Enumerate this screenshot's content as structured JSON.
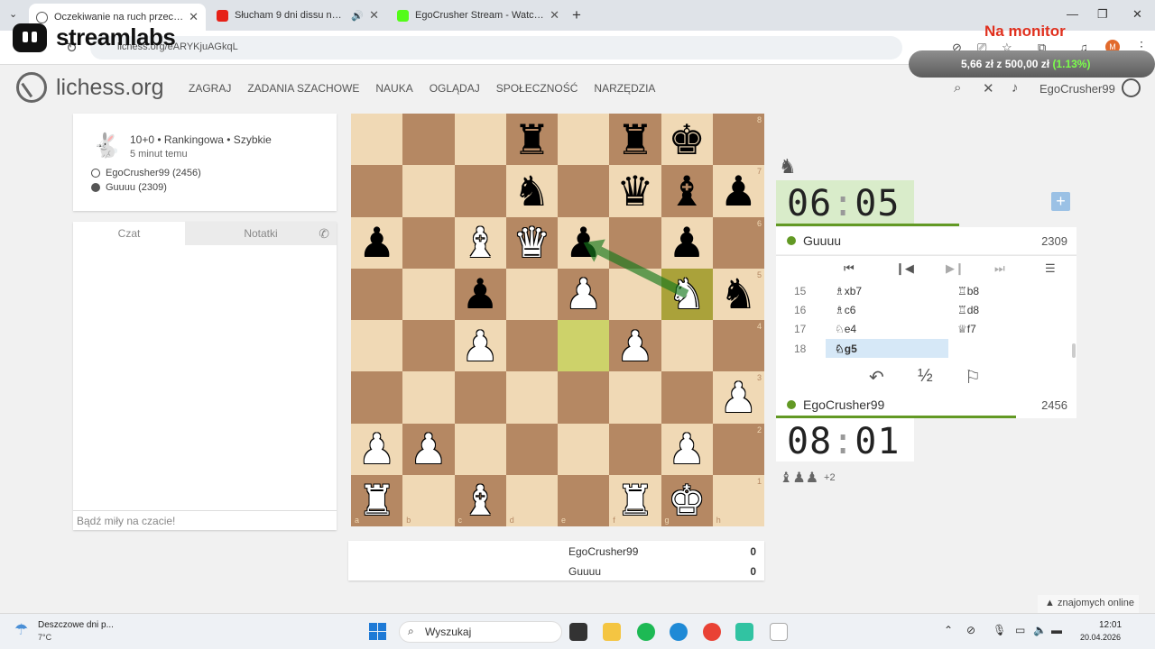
{
  "browser": {
    "tabs": [
      {
        "title": "Oczekiwanie na ruch przeciwnika",
        "favicon_color": "#ffffff",
        "active": true
      },
      {
        "title": "Słucham 9 dni dissu na raka",
        "favicon_color": "#e62117",
        "active": false
      },
      {
        "title": "EgoCrusher Stream - Watch Live",
        "favicon_color": "#53fc18",
        "active": false
      }
    ],
    "url": "lichess.org/eARYKjuAGkqL"
  },
  "overlay": {
    "brand": "streamlabs",
    "goal_title": "Na monitor",
    "goal_current": "5,66 zł",
    "goal_sep": "z",
    "goal_target": "500,00 zł",
    "goal_percent": "(1.13%)",
    "progress_fraction": 0.0113
  },
  "site": {
    "name": "lichess.org",
    "nav": [
      "ZAGRAJ",
      "ZADANIA SZACHOWE",
      "NAUKA",
      "OGLĄDAJ",
      "SPOŁECZNOŚĆ",
      "NARZĘDZIA"
    ],
    "username": "EgoCrusher99"
  },
  "game": {
    "mode": "10+0 • Rankingowa • Szybkie",
    "started": "5 minut temu",
    "white": "EgoCrusher99 (2456)",
    "black": "Guuuu (2309)"
  },
  "chat": {
    "tab_chat": "Czat",
    "tab_notes": "Notatki",
    "placeholder": "Bądź miły na czacie!"
  },
  "board": {
    "files": [
      "a",
      "b",
      "c",
      "d",
      "e",
      "f",
      "g",
      "h"
    ],
    "ranks": [
      "8",
      "7",
      "6",
      "5",
      "4",
      "3",
      "2",
      "1"
    ],
    "position": [
      [
        "",
        "",
        "",
        "r",
        "",
        "r",
        "k",
        ""
      ],
      [
        "",
        "",
        "",
        "n",
        "",
        "q",
        "b",
        "p"
      ],
      [
        "p",
        "",
        "B",
        "Q",
        "p",
        "",
        "p",
        ""
      ],
      [
        "",
        "",
        "p",
        "",
        "P",
        "",
        "N",
        "n"
      ],
      [
        "",
        "",
        "P",
        "",
        "",
        "P",
        "",
        ""
      ],
      [
        "",
        "",
        "",
        "",
        "",
        "",
        "",
        "P"
      ],
      [
        "P",
        "P",
        "",
        "",
        "",
        "",
        "P",
        ""
      ],
      [
        "R",
        "",
        "B",
        "",
        "",
        "R",
        "K",
        ""
      ]
    ],
    "last_move": [
      "e4",
      "g5"
    ],
    "arrow": {
      "from": "g5",
      "to": "e6",
      "color": "#15781b"
    }
  },
  "score": {
    "rows": [
      {
        "name": "EgoCrusher99",
        "value": "0"
      },
      {
        "name": "Guuuu",
        "value": "0"
      }
    ]
  },
  "opponent": {
    "name": "Guuuu",
    "rating": "2309",
    "clock_min": "06",
    "clock_sec": "05",
    "time_fraction": 0.61
  },
  "me": {
    "name": "EgoCrusher99",
    "rating": "2456",
    "clock_min": "08",
    "clock_sec": "01",
    "time_fraction": 0.8
  },
  "moves": [
    {
      "num": "15",
      "white": "♗xb7",
      "black": "♖b8"
    },
    {
      "num": "16",
      "white": "♗c6",
      "black": "♖d8"
    },
    {
      "num": "17",
      "white": "♘e4",
      "black": "♕f7"
    },
    {
      "num": "18",
      "white": "♘g5",
      "black": ""
    }
  ],
  "actions": {
    "draw": "½"
  },
  "captured": {
    "extra": "+2"
  },
  "friends": "znajomych online",
  "taskbar": {
    "weather_title": "Deszczowe dni p...",
    "weather_temp": "7°C",
    "search": "Wyszukaj",
    "time": "12:01",
    "date": "20.04.2026"
  }
}
